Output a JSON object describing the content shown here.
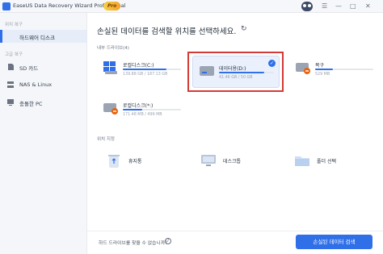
{
  "window": {
    "title": "EaseUS Data Recovery Wizard Professional",
    "badge": "Pro",
    "controls": [
      "☰",
      "—",
      "□",
      "✕"
    ]
  },
  "sidebar": {
    "section1": "위치 복구",
    "section2": "고급 복구",
    "items": [
      {
        "label": "하드웨어 디스크",
        "active": true
      },
      {
        "label": "SD 카드",
        "icon": "sd-card-icon"
      },
      {
        "label": "NAS & Linux",
        "icon": "nas-icon"
      },
      {
        "label": "충돌한 PC",
        "icon": "crashed-pc-icon"
      }
    ]
  },
  "main": {
    "title": "손실된 데이터를 검색할 위치를 선택하세요.",
    "internal_label": "내부 드라이브(4)",
    "drives": [
      {
        "name": "로컬디스크(C:)",
        "size": "139.88 GB / 187.13 GB",
        "fill": 0.75,
        "icon": "windows-drive-icon"
      },
      {
        "name": "데이터용(D:)",
        "size": "41.46 GB / 50 GB",
        "fill": 0.83,
        "icon": "drive-icon",
        "selected": true
      },
      {
        "name": "복구",
        "size": "529 MB",
        "fill": 0.3,
        "icon": "drive-warning-icon"
      },
      {
        "name": "로컬디스크(*:)",
        "size": "171.48 MB / 499 MB",
        "fill": 0.34,
        "icon": "drive-warning-icon"
      }
    ],
    "location_label": "위치 지정",
    "locations": [
      {
        "name": "휴지통",
        "icon": "recycle-bin-icon"
      },
      {
        "name": "데스크톱",
        "icon": "desktop-icon"
      },
      {
        "name": "폴더 선택",
        "icon": "folder-icon"
      }
    ]
  },
  "footer": {
    "help": "하드 드라이브를 찾을 수 없습니까?",
    "help_icon": "?",
    "scan_button": "손실된 데이터 검색"
  },
  "colors": {
    "accent": "#2f6fe8",
    "highlight": "#d43a35"
  }
}
